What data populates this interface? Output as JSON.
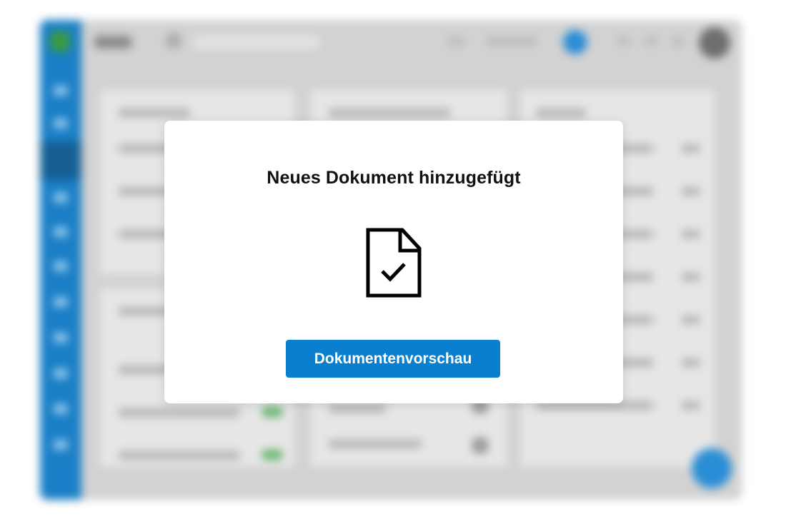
{
  "modal": {
    "title": "Neues Dokument hinzugefügt",
    "icon": "document-check-icon",
    "button_label": "Dokumentenvorschau",
    "button_color": "#0a7fce"
  },
  "background": {
    "rail_color": "#1a7fc6",
    "accent_color": "#2a8ed6",
    "status_color": "#63b36a",
    "blurred": true
  }
}
